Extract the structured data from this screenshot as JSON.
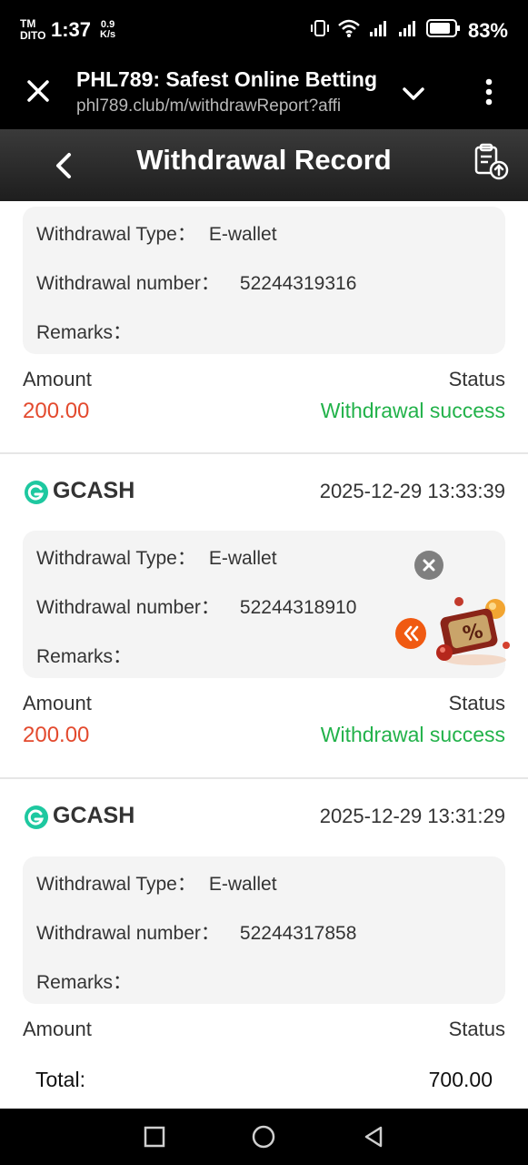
{
  "status_bar": {
    "carrier_top": "TM",
    "carrier_bottom": "DITO",
    "time": "1:37",
    "speed_value": "0.9",
    "speed_unit": "K/s",
    "battery": "83%"
  },
  "browser": {
    "title": "PHL789: Safest Online Betting",
    "url": "phl789.club/m/withdrawReport?affi"
  },
  "header": {
    "title": "Withdrawal Record"
  },
  "labels": {
    "type": "Withdrawal Type：",
    "number": "Withdrawal number：",
    "remarks": "Remarks：",
    "amount": "Amount",
    "status": "Status"
  },
  "records": [
    {
      "provider": "",
      "datetime": "",
      "type": "E-wallet",
      "number": "52244319316",
      "remarks": "",
      "amount": "200.00",
      "status": "Withdrawal success"
    },
    {
      "provider": "GCASH",
      "datetime": "2025-12-29 13:33:39",
      "type": "E-wallet",
      "number": "52244318910",
      "remarks": "",
      "amount": "200.00",
      "status": "Withdrawal success"
    },
    {
      "provider": "GCASH",
      "datetime": "2025-12-29 13:31:29",
      "type": "E-wallet",
      "number": "52244317858",
      "remarks": "",
      "amount": "",
      "status": ""
    }
  ],
  "total": {
    "label": "Total:",
    "value": "700.00"
  },
  "colors": {
    "amount": "#e34a2e",
    "status_success": "#22b24a",
    "gcash_brand": "#1ec8a0"
  }
}
